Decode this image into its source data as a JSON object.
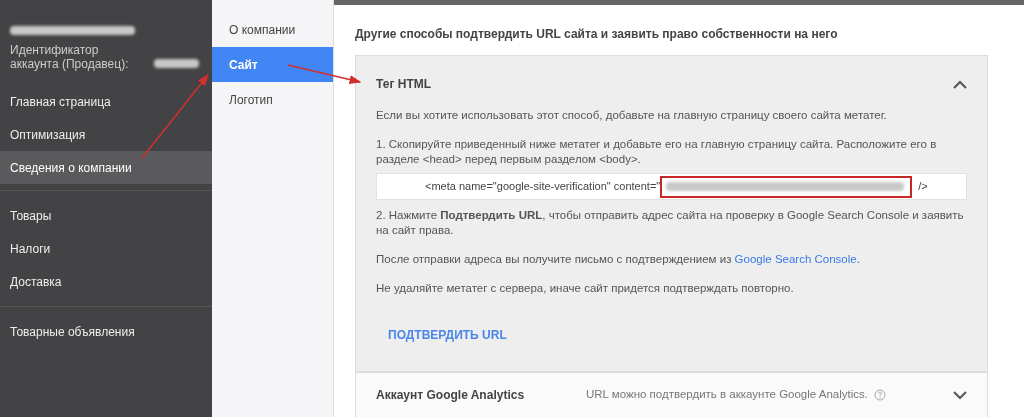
{
  "sidebar": {
    "account_id_label": "Идентификатор аккаунта (Продавец):",
    "groups": [
      [
        {
          "label": "Главная страница",
          "selected": false
        },
        {
          "label": "Оптимизация",
          "selected": false
        },
        {
          "label": "Сведения о компании",
          "selected": true
        }
      ],
      [
        {
          "label": "Товары",
          "selected": false
        },
        {
          "label": "Налоги",
          "selected": false
        },
        {
          "label": "Доставка",
          "selected": false
        }
      ],
      [
        {
          "label": "Товарные объявления",
          "selected": false
        }
      ]
    ]
  },
  "subnav": [
    {
      "label": "О компании",
      "selected": false
    },
    {
      "label": "Сайт",
      "selected": true
    },
    {
      "label": "Логотип",
      "selected": false
    }
  ],
  "page_title": "Другие способы подтвердить URL сайта и заявить право собственности на него",
  "methods": [
    {
      "title": "Тег HTML",
      "expanded": true,
      "intro": "Если вы хотите использовать этот способ, добавьте на главную страницу своего сайта метатег.",
      "step_1": "1. Скопируйте приведенный ниже метатег и добавьте его на главную страницу сайта. Расположите его в разделе <head> перед первым разделом <body>.",
      "code_prefix": "<meta name=\"google-site-verification\" content=\"",
      "code_suffix": "/>",
      "step_2": "2. Нажмите **Подтвердить URL**, чтобы отправить адрес сайта на проверку в Google Search Console и заявить на сайт права.",
      "notice": "После отправки адреса вы получите письмо с подтверждением из",
      "notice_link": "Google Search Console",
      "notice_end": ".",
      "warning": "Не удаляйте метатег с сервера, иначе сайт придется подтверждать повторно.",
      "button": "ПОДТВЕРДИТЬ URL"
    },
    {
      "title": "Аккаунт Google Analytics",
      "expanded": false,
      "summary": "URL можно подтвердить в аккаунте Google Analytics."
    }
  ]
}
